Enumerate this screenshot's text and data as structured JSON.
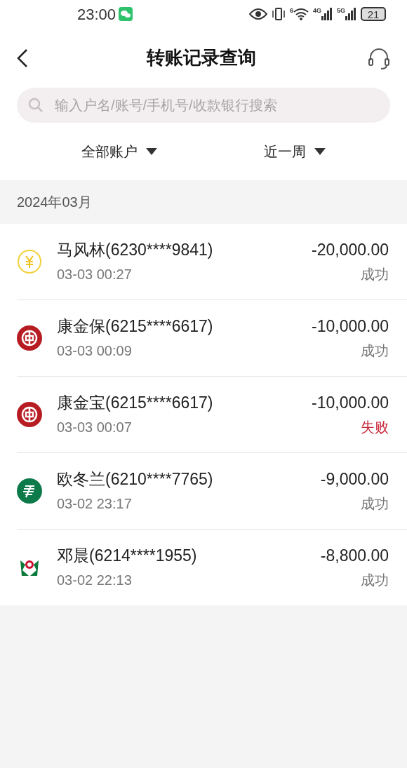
{
  "status_bar": {
    "time": "23:00",
    "wifi_label": "6",
    "signal_1": "4G",
    "signal_2": "5G",
    "battery": "21"
  },
  "header": {
    "title": "转账记录查询"
  },
  "search": {
    "placeholder": "输入户名/账号/手机号/收款银行搜索"
  },
  "filters": [
    {
      "label": "全部账户"
    },
    {
      "label": "近一周"
    }
  ],
  "month": "2024年03月",
  "records": [
    {
      "kind": "yuan",
      "name": "马风林(6230****9841)",
      "time": "03-03 00:27",
      "amount": "-20,000.00",
      "status": "成功",
      "failed": false
    },
    {
      "kind": "boc",
      "name": "康金保(6215****6617)",
      "time": "03-03 00:09",
      "amount": "-10,000.00",
      "status": "成功",
      "failed": false
    },
    {
      "kind": "boc",
      "name": "康金宝(6215****6617)",
      "time": "03-03 00:07",
      "amount": "-10,000.00",
      "status": "失败",
      "failed": true
    },
    {
      "kind": "post",
      "name": "欧冬兰(6210****7765)",
      "time": "03-02 23:17",
      "amount": "-9,000.00",
      "status": "成功",
      "failed": false
    },
    {
      "kind": "abc",
      "name": "邓晨(6214****1955)",
      "time": "03-02 22:13",
      "amount": "-8,800.00",
      "status": "成功",
      "failed": false
    }
  ]
}
